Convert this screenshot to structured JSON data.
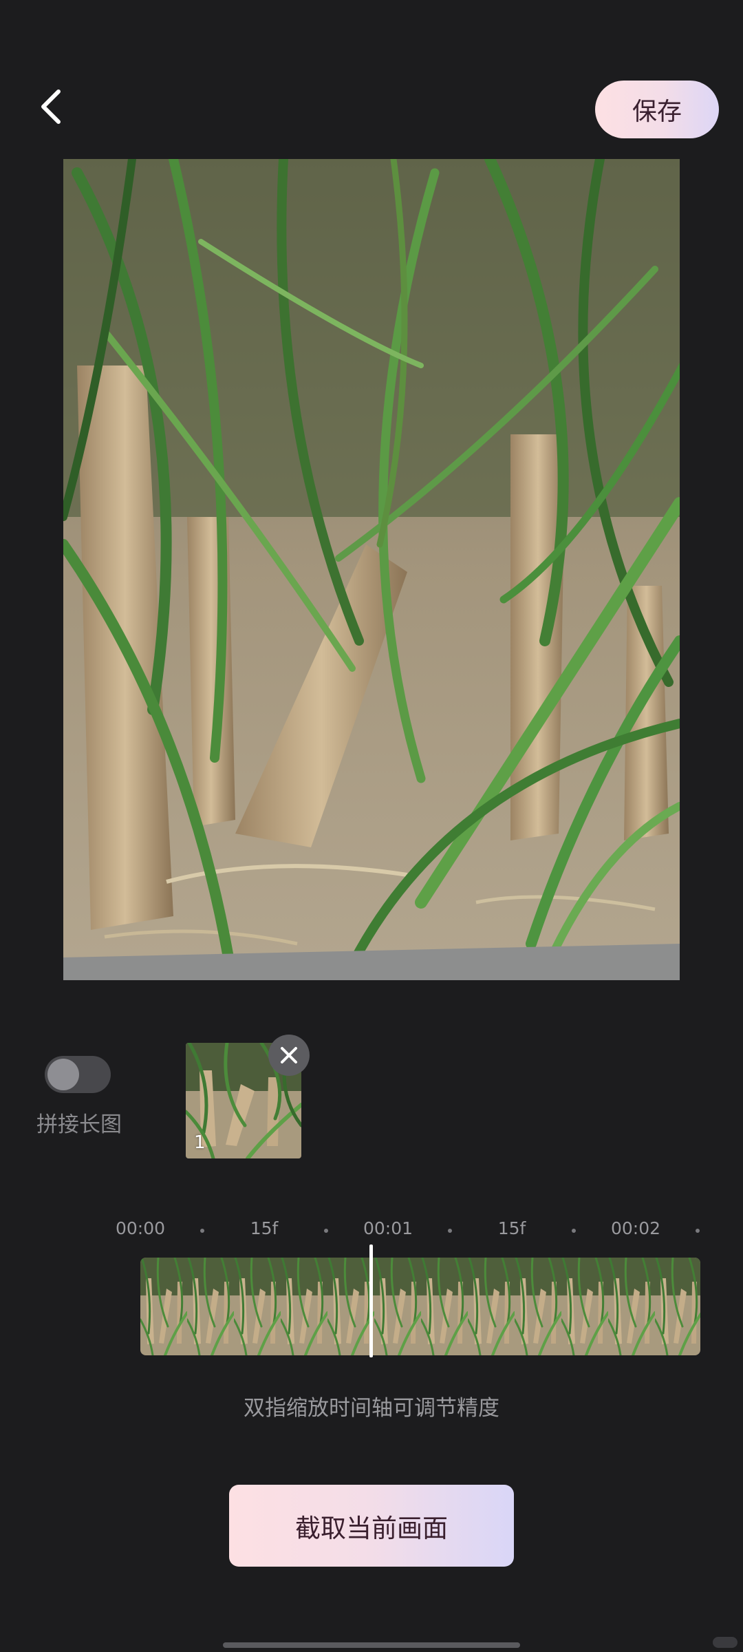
{
  "header": {
    "back_icon": "chevron-left-icon",
    "save_label": "保存"
  },
  "preview": {
    "image_description_icon": "photo-preview"
  },
  "stitch": {
    "toggle_label": "拼接长图",
    "enabled": false
  },
  "thumbnails": [
    {
      "index": "1"
    }
  ],
  "timeline": {
    "ticks": [
      {
        "label": "00:00"
      },
      {
        "label": "15f"
      },
      {
        "label": "00:01"
      },
      {
        "label": "15f"
      },
      {
        "label": "00:02"
      }
    ],
    "hint": "双指缩放时间轴可调节精度"
  },
  "actions": {
    "capture_label": "截取当前画面"
  },
  "colors": {
    "background": "#1c1c1e",
    "accent_gradient_start": "#fde0e3",
    "accent_gradient_end": "#d9d6f7",
    "playhead": "#ffffff"
  }
}
